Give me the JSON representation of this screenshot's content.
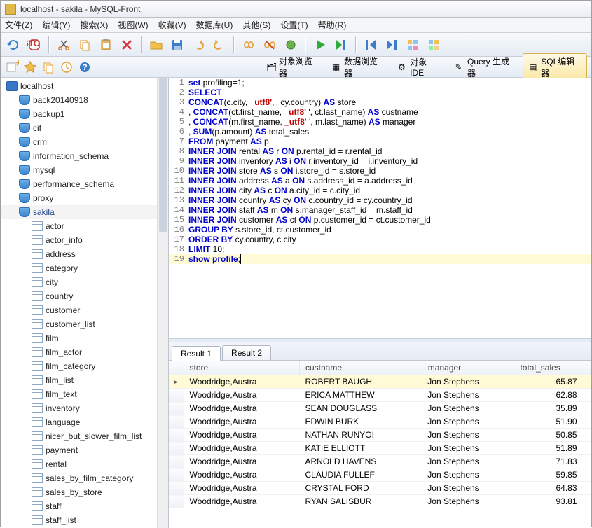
{
  "window": {
    "title": "localhost - sakila - MySQL-Front"
  },
  "menu": {
    "items": [
      "文件(Z)",
      "编辑(Y)",
      "搜索(X)",
      "视图(W)",
      "收藏(V)",
      "数据库(U)",
      "其他(S)",
      "设置(T)",
      "帮助(R)"
    ]
  },
  "views": {
    "object_browser": "对象浏览器",
    "data_browser": "数据浏览器",
    "object_ide": "对象 IDE",
    "query_builder": "Query 生成器",
    "sql_editor": "SQL编辑器"
  },
  "tree": {
    "root": "localhost",
    "databases": [
      "back20140918",
      "backup1",
      "cif",
      "crm",
      "information_schema",
      "mysql",
      "performance_schema",
      "proxy",
      "sakila"
    ],
    "selected_db_index": 8,
    "tables": [
      "actor",
      "actor_info",
      "address",
      "category",
      "city",
      "country",
      "customer",
      "customer_list",
      "film",
      "film_actor",
      "film_category",
      "film_list",
      "film_text",
      "inventory",
      "language",
      "nicer_but_slower_film_list",
      "payment",
      "rental",
      "sales_by_film_category",
      "sales_by_store",
      "staff",
      "staff_list"
    ]
  },
  "sql_lines": [
    [
      {
        "t": "kw",
        "v": "set"
      },
      {
        "t": "plain",
        "v": " profiling=1;"
      }
    ],
    [
      {
        "t": "kw",
        "v": "SELECT"
      }
    ],
    [
      {
        "t": "kw",
        "v": "CONCAT"
      },
      {
        "t": "plain",
        "v": "(c.city, "
      },
      {
        "t": "str",
        "v": "_utf8'"
      },
      {
        "t": "plain",
        "v": ",', cy.country) "
      },
      {
        "t": "kw",
        "v": "AS"
      },
      {
        "t": "plain",
        "v": " store"
      }
    ],
    [
      {
        "t": "plain",
        "v": ", "
      },
      {
        "t": "kw",
        "v": "CONCAT"
      },
      {
        "t": "plain",
        "v": "(ct.first_name, "
      },
      {
        "t": "str",
        "v": "_utf8'"
      },
      {
        "t": "plain",
        "v": " ', ct.last_name) "
      },
      {
        "t": "kw",
        "v": "AS"
      },
      {
        "t": "plain",
        "v": " custname"
      }
    ],
    [
      {
        "t": "plain",
        "v": ", "
      },
      {
        "t": "kw",
        "v": "CONCAT"
      },
      {
        "t": "plain",
        "v": "(m.first_name, "
      },
      {
        "t": "str",
        "v": "_utf8'"
      },
      {
        "t": "plain",
        "v": " ', m.last_name) "
      },
      {
        "t": "kw",
        "v": "AS"
      },
      {
        "t": "plain",
        "v": " manager"
      }
    ],
    [
      {
        "t": "plain",
        "v": ", "
      },
      {
        "t": "kw",
        "v": "SUM"
      },
      {
        "t": "plain",
        "v": "(p.amount) "
      },
      {
        "t": "kw",
        "v": "AS"
      },
      {
        "t": "plain",
        "v": " total_sales"
      }
    ],
    [
      {
        "t": "kw",
        "v": "FROM"
      },
      {
        "t": "plain",
        "v": " payment "
      },
      {
        "t": "kw",
        "v": "AS"
      },
      {
        "t": "plain",
        "v": " p"
      }
    ],
    [
      {
        "t": "kw",
        "v": "INNER JOIN"
      },
      {
        "t": "plain",
        "v": " rental "
      },
      {
        "t": "kw",
        "v": "AS"
      },
      {
        "t": "plain",
        "v": " r "
      },
      {
        "t": "kw",
        "v": "ON"
      },
      {
        "t": "plain",
        "v": " p.rental_id = r.rental_id"
      }
    ],
    [
      {
        "t": "kw",
        "v": "INNER JOIN"
      },
      {
        "t": "plain",
        "v": " inventory "
      },
      {
        "t": "kw",
        "v": "AS"
      },
      {
        "t": "plain",
        "v": " i "
      },
      {
        "t": "kw",
        "v": "ON"
      },
      {
        "t": "plain",
        "v": " r.inventory_id = i.inventory_id"
      }
    ],
    [
      {
        "t": "kw",
        "v": "INNER JOIN"
      },
      {
        "t": "plain",
        "v": " store "
      },
      {
        "t": "kw",
        "v": "AS"
      },
      {
        "t": "plain",
        "v": " s "
      },
      {
        "t": "kw",
        "v": "ON"
      },
      {
        "t": "plain",
        "v": " i.store_id = s.store_id"
      }
    ],
    [
      {
        "t": "kw",
        "v": "INNER JOIN"
      },
      {
        "t": "plain",
        "v": " address "
      },
      {
        "t": "kw",
        "v": "AS"
      },
      {
        "t": "plain",
        "v": " a "
      },
      {
        "t": "kw",
        "v": "ON"
      },
      {
        "t": "plain",
        "v": " s.address_id = a.address_id"
      }
    ],
    [
      {
        "t": "kw",
        "v": "INNER JOIN"
      },
      {
        "t": "plain",
        "v": " city "
      },
      {
        "t": "kw",
        "v": "AS"
      },
      {
        "t": "plain",
        "v": " c "
      },
      {
        "t": "kw",
        "v": "ON"
      },
      {
        "t": "plain",
        "v": " a.city_id = c.city_id"
      }
    ],
    [
      {
        "t": "kw",
        "v": "INNER JOIN"
      },
      {
        "t": "plain",
        "v": " country "
      },
      {
        "t": "kw",
        "v": "AS"
      },
      {
        "t": "plain",
        "v": " cy "
      },
      {
        "t": "kw",
        "v": "ON"
      },
      {
        "t": "plain",
        "v": " c.country_id = cy.country_id"
      }
    ],
    [
      {
        "t": "kw",
        "v": "INNER JOIN"
      },
      {
        "t": "plain",
        "v": " staff "
      },
      {
        "t": "kw",
        "v": "AS"
      },
      {
        "t": "plain",
        "v": " m "
      },
      {
        "t": "kw",
        "v": "ON"
      },
      {
        "t": "plain",
        "v": " s.manager_staff_id = m.staff_id"
      }
    ],
    [
      {
        "t": "kw",
        "v": "INNER JOIN"
      },
      {
        "t": "plain",
        "v": " customer "
      },
      {
        "t": "kw",
        "v": "AS"
      },
      {
        "t": "plain",
        "v": " ct "
      },
      {
        "t": "kw",
        "v": "ON"
      },
      {
        "t": "plain",
        "v": " p.customer_id = ct.customer_id"
      }
    ],
    [
      {
        "t": "kw",
        "v": "GROUP BY"
      },
      {
        "t": "plain",
        "v": " s.store_id, ct.customer_id"
      }
    ],
    [
      {
        "t": "kw",
        "v": "ORDER BY"
      },
      {
        "t": "plain",
        "v": " cy.country, c.city"
      }
    ],
    [
      {
        "t": "kw",
        "v": "LIMIT"
      },
      {
        "t": "plain",
        "v": " 10;"
      }
    ],
    [
      {
        "t": "kw",
        "v": "show profile"
      },
      {
        "t": "plain",
        "v": ";"
      }
    ]
  ],
  "current_line": 19,
  "results": {
    "tabs": [
      "Result 1",
      "Result 2"
    ],
    "active_tab": 0,
    "columns": [
      "store",
      "custname",
      "manager",
      "total_sales"
    ],
    "rows": [
      [
        "Woodridge,Austra",
        "ROBERT BAUGH",
        "Jon Stephens",
        "65.87"
      ],
      [
        "Woodridge,Austra",
        "ERICA MATTHEW",
        "Jon Stephens",
        "62.88"
      ],
      [
        "Woodridge,Austra",
        "SEAN DOUGLASS",
        "Jon Stephens",
        "35.89"
      ],
      [
        "Woodridge,Austra",
        "EDWIN BURK",
        "Jon Stephens",
        "51.90"
      ],
      [
        "Woodridge,Austra",
        "NATHAN RUNYOI",
        "Jon Stephens",
        "50.85"
      ],
      [
        "Woodridge,Austra",
        "KATIE ELLIOTT",
        "Jon Stephens",
        "51.89"
      ],
      [
        "Woodridge,Austra",
        "ARNOLD HAVENS",
        "Jon Stephens",
        "71.83"
      ],
      [
        "Woodridge,Austra",
        "CLAUDIA FULLEF",
        "Jon Stephens",
        "59.85"
      ],
      [
        "Woodridge,Austra",
        "CRYSTAL FORD",
        "Jon Stephens",
        "64.83"
      ],
      [
        "Woodridge,Austra",
        "RYAN SALISBUR",
        "Jon Stephens",
        "93.81"
      ]
    ],
    "selected_row": 0
  },
  "toolbar_icons": [
    "refresh",
    "stop",
    "cut",
    "copy",
    "paste",
    "delete",
    "undo",
    "save",
    "back",
    "redo",
    "link",
    "break",
    "bookmark",
    "run",
    "step",
    "first",
    "last",
    "grid1",
    "grid2"
  ]
}
